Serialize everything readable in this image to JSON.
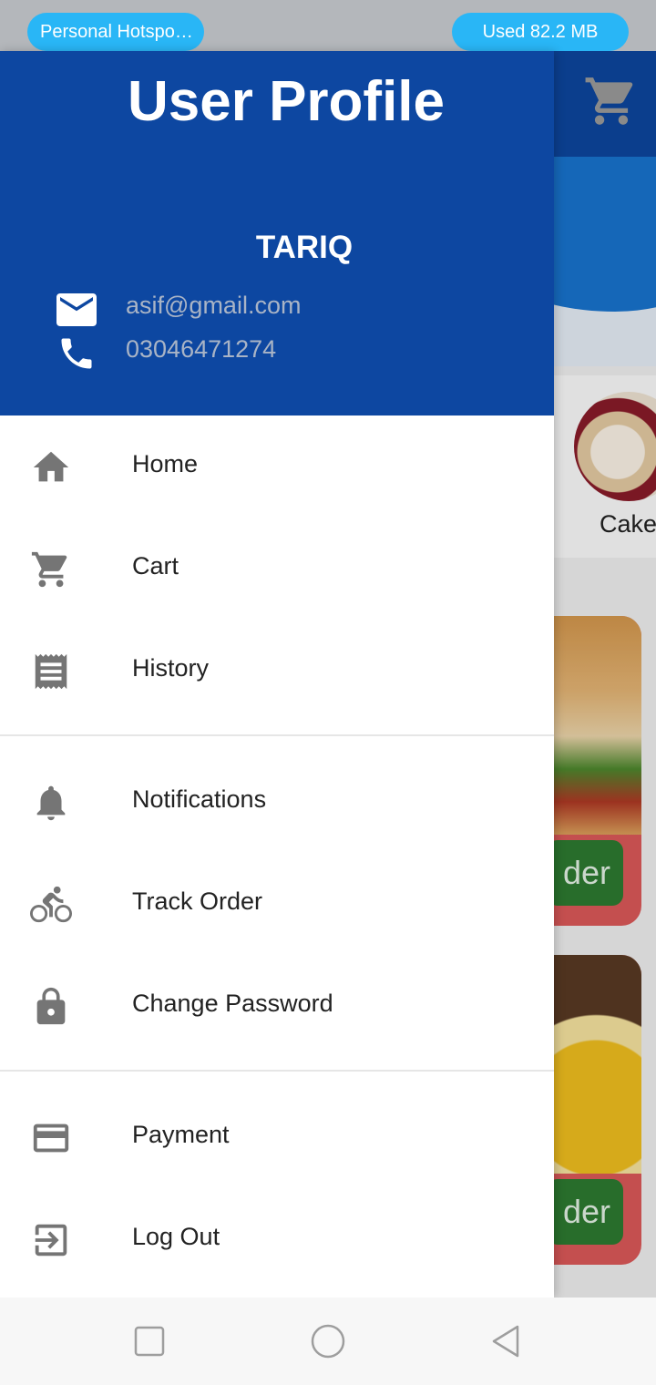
{
  "status_bar": {
    "hotspot_label": "Personal Hotspo…",
    "data_used_label": "Used  82.2 MB"
  },
  "background": {
    "category_label": "Cake",
    "order_button_label": "der"
  },
  "drawer": {
    "title": "User Profile",
    "user_name": "TARIQ",
    "email": "asif@gmail.com",
    "phone": "03046471274",
    "items": [
      {
        "label": "Home",
        "icon": "home-icon"
      },
      {
        "label": "Cart",
        "icon": "cart-icon"
      },
      {
        "label": "History",
        "icon": "receipt-icon"
      },
      {
        "label": "Notifications",
        "icon": "bell-icon"
      },
      {
        "label": "Track Order",
        "icon": "bicycle-icon"
      },
      {
        "label": "Change Password",
        "icon": "lock-icon"
      },
      {
        "label": "Payment",
        "icon": "credit-card-icon"
      },
      {
        "label": "Log Out",
        "icon": "logout-icon"
      }
    ]
  },
  "colors": {
    "header_blue": "#0d47a1",
    "icon_gray": "#757575",
    "hotspot_pill": "#29b6f6"
  }
}
